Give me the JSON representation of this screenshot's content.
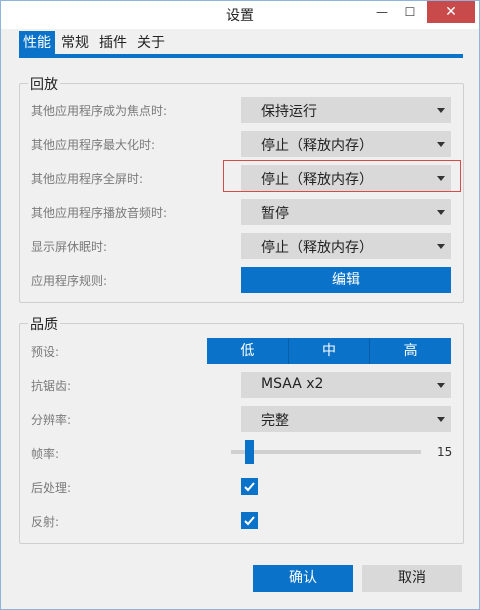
{
  "window": {
    "title": "设置",
    "min_glyph": "—",
    "max_glyph": "☐",
    "close_glyph": "✕"
  },
  "tabs": [
    {
      "label": "性能",
      "active": true
    },
    {
      "label": "常规",
      "active": false
    },
    {
      "label": "插件",
      "active": false
    },
    {
      "label": "关于",
      "active": false
    }
  ],
  "playback": {
    "title": "回放",
    "rows": [
      {
        "label": "其他应用程序成为焦点时:",
        "value": "保持运行"
      },
      {
        "label": "其他应用程序最大化时:",
        "value": "停止（释放内存）"
      },
      {
        "label": "其他应用程序全屏时:",
        "value": "停止（释放内存）"
      },
      {
        "label": "其他应用程序播放音频时:",
        "value": "暂停"
      },
      {
        "label": "显示屏休眠时:",
        "value": "停止（释放内存）"
      }
    ],
    "rules_label": "应用程序规则:",
    "rules_button": "编辑"
  },
  "quality": {
    "title": "品质",
    "preset_label": "预设:",
    "presets": [
      "低",
      "中",
      "高"
    ],
    "aa_label": "抗锯齿:",
    "aa_value": "MSAA x2",
    "resolution_label": "分辨率:",
    "resolution_value": "完整",
    "fps_label": "帧率:",
    "fps_value": "15",
    "postproc_label": "后处理:",
    "postproc_checked": true,
    "reflect_label": "反射:",
    "reflect_checked": true
  },
  "footer": {
    "ok": "确认",
    "cancel": "取消"
  },
  "colors": {
    "accent": "#0a73c9",
    "highlight_border": "#d84a4a",
    "close_bg": "#c94a4a"
  }
}
